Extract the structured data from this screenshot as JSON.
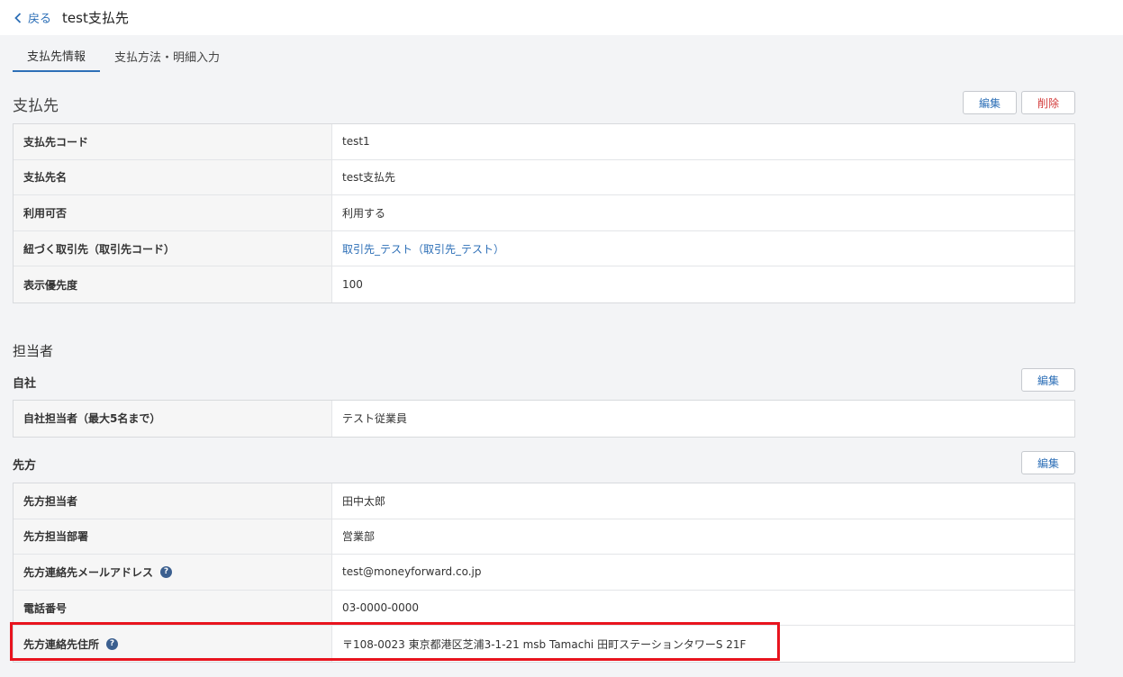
{
  "header": {
    "back_label": "戻る",
    "title": "test支払先"
  },
  "tabs": [
    {
      "label": "支払先情報",
      "active": true
    },
    {
      "label": "支払方法・明細入力",
      "active": false
    }
  ],
  "payee_section": {
    "title": "支払先",
    "edit_label": "編集",
    "delete_label": "削除",
    "rows": [
      {
        "label": "支払先コード",
        "value": "test1"
      },
      {
        "label": "支払先名",
        "value": "test支払先"
      },
      {
        "label": "利用可否",
        "value": "利用する"
      },
      {
        "label": "紐づく取引先（取引先コード）",
        "value": "取引先_テスト（取引先_テスト）"
      },
      {
        "label": "表示優先度",
        "value": "100"
      }
    ]
  },
  "contact_section": {
    "title": "担当者",
    "own": {
      "title": "自社",
      "edit_label": "編集",
      "rows": [
        {
          "label": "自社担当者（最大5名まで）",
          "value": "テスト従業員"
        }
      ]
    },
    "partner": {
      "title": "先方",
      "edit_label": "編集",
      "rows": [
        {
          "label": "先方担当者",
          "value": "田中太郎"
        },
        {
          "label": "先方担当部署",
          "value": "営業部"
        },
        {
          "label": "先方連絡先メールアドレス",
          "value": "test@moneyforward.co.jp"
        },
        {
          "label": "電話番号",
          "value": "03-0000-0000"
        },
        {
          "label": "先方連絡先住所",
          "value": "〒108-0023 東京都港区芝浦3-1-21 msb Tamachi 田町ステーションタワーS 21F"
        }
      ]
    }
  },
  "icons": {
    "back": "chevron-left-icon",
    "help": "question-circle-icon"
  },
  "colors": {
    "accent": "#2d6fb7",
    "danger": "#d33a3a",
    "highlight": "#e8141e"
  }
}
